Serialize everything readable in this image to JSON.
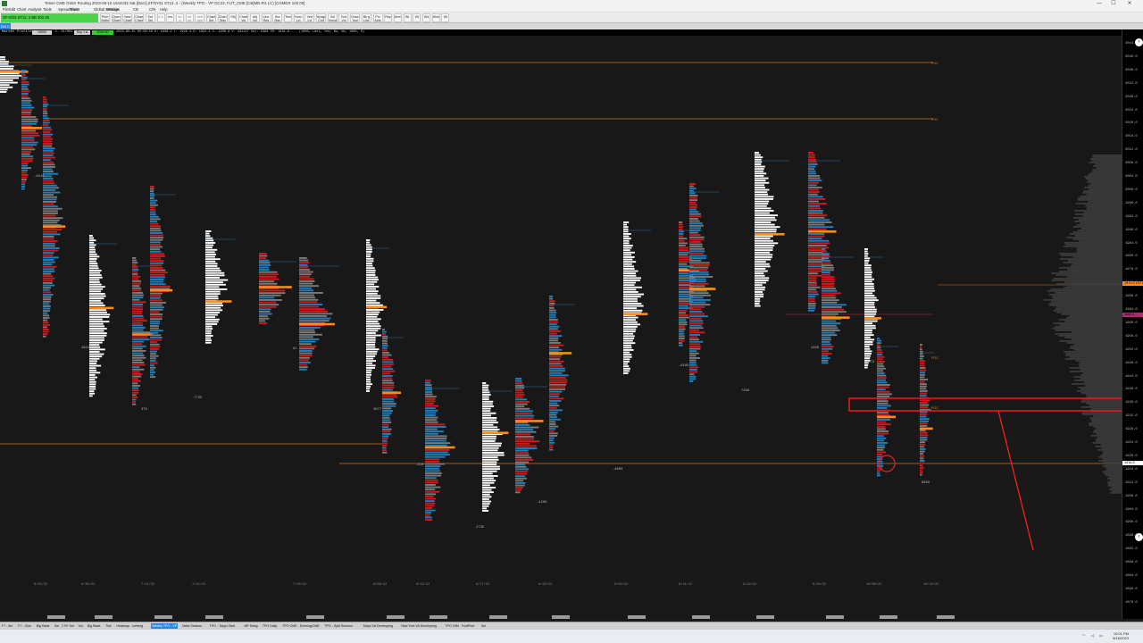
{
  "window": {
    "title": "Tetser CME Order Routing 2023-08-16  1544432 Sat [Dar1] ZF/5Y01  ST12, 2 - (Weekly TPO - VP GC23, FUT_CME [CB]MD-R3 LC) [CGMDX 100 00]",
    "minimize": "—",
    "maximize": "☐",
    "close": "✕"
  },
  "menu": [
    "File",
    "Edit",
    "Chart",
    "Analysis",
    "Tools",
    "Spreadsheet",
    "Trade",
    "Global Settings",
    "Window",
    "CB",
    "C/N",
    "Help"
  ],
  "symbol_box": "GF-5/23  ST12, 2   BB 202.25",
  "toolbar_buttons": [
    "Print Splits",
    "Open Charts",
    "New Charts",
    "Close Charts",
    "Ent Set",
    "< >",
    "Ins",
    "<< <",
    "<< >>",
    "<<< >>>",
    "Chart Set",
    "Chart Stdy",
    "Obj",
    "Chart Vol",
    "Adj Vol",
    "Line Reg",
    "Hor Ray",
    "Text",
    "Horz Lvl",
    "Vert Lvl",
    "Kpage Chrt",
    "Vol Vmcd",
    "Tool Vol",
    "Draw Tool Set",
    "Bk g Linx",
    "Prv Alrts",
    "Reply",
    "Arrest",
    "Wt",
    "Wt",
    "Wd",
    "Wnk",
    "Wt"
  ],
  "chart_tab": "Bid C",
  "study": {
    "name": "Market Profile",
    "box": "10000",
    "info": "C: 517001",
    "bid": "Doy 1 A",
    "ask": "2020.00 0+000",
    "data": "2023-08-15 05:58:59  H: 1938.2  L: 1926.4  O: 1932.1  C: 1930.8  V: 431227  Vol: 5398  TR: 1931.8 ... (1000, Last, Yes, No, No, 1000, 0)"
  },
  "price_axis": {
    "ticks": [
      "2044.0",
      "2040.0",
      "2036.0",
      "2032.0",
      "2028.0",
      "2024.0",
      "2020.0",
      "2016.0",
      "2012.0",
      "2008.0",
      "2004.0",
      "2000.0",
      "1996.0",
      "1992.0",
      "1988.0",
      "1984.0",
      "1980.0",
      "1976.0",
      "1972.0",
      "1968.0",
      "1964.0",
      "1960.0",
      "1956.0",
      "1952.0",
      "1948.0",
      "1944.0",
      "1940.0",
      "1936.0",
      "1932.0",
      "1928.0",
      "1924.0",
      "1920.0",
      "1916.0",
      "1912.0",
      "1908.0",
      "1904.0",
      "1900.0",
      "1896.0",
      "1892.0",
      "1888.0",
      "1884.0",
      "1880.0",
      "1876.0"
    ],
    "highlight_orange": "1972.0  1971",
    "highlight_magenta": "1966.1",
    "highlight_white": "1916.5"
  },
  "profile_dates": [
    "6/25/22",
    "6/30/22",
    "7/11/22",
    "7/21/22",
    "7/28/22",
    "8/09/22",
    "8/15/22",
    "8/17/22",
    "8/23/22",
    "9/02/22",
    "9/11/22",
    "9/22/22",
    "9/29/22",
    "10/06/22",
    "10/18/22"
  ],
  "delta_labels": [
    "-4016",
    "4841",
    "379",
    "-7725",
    "61",
    "3077",
    "-118",
    "-2735",
    "-4206",
    "-4000",
    "-6195",
    "7298",
    "1296",
    "8072",
    "9660"
  ],
  "poc_label": "POC",
  "tabs": [
    "F? - 5m",
    "F? - 30m",
    "Big Rade",
    "5m",
    "2 R+ 5m",
    "Vol",
    "Big Rade",
    "Tick",
    "Heatmap - Iceberg",
    "Weekly TPO - VP",
    "Delta Session",
    "TPO - Tokyo Start",
    "MP Setup",
    "TPO Daily",
    "TPO CME - Evening/CME",
    "TPO - Split Session",
    "Tokyo VA Developing",
    "New York VA Developing",
    "TPO 15M",
    "FootPrint",
    "5m"
  ],
  "active_tab_index": 9,
  "taskbar": {
    "clock_time": "10:01 PM",
    "clock_date": "8/16/2023"
  },
  "colors": {
    "background": "#181818",
    "profile_white": "#ffffff",
    "profile_red": "#d11a1a",
    "profile_blue": "#1f7fbf",
    "profile_grey": "#7a7a7a",
    "poc_orange": "#ff8c1a",
    "annotation_red": "#ff1a1a"
  }
}
